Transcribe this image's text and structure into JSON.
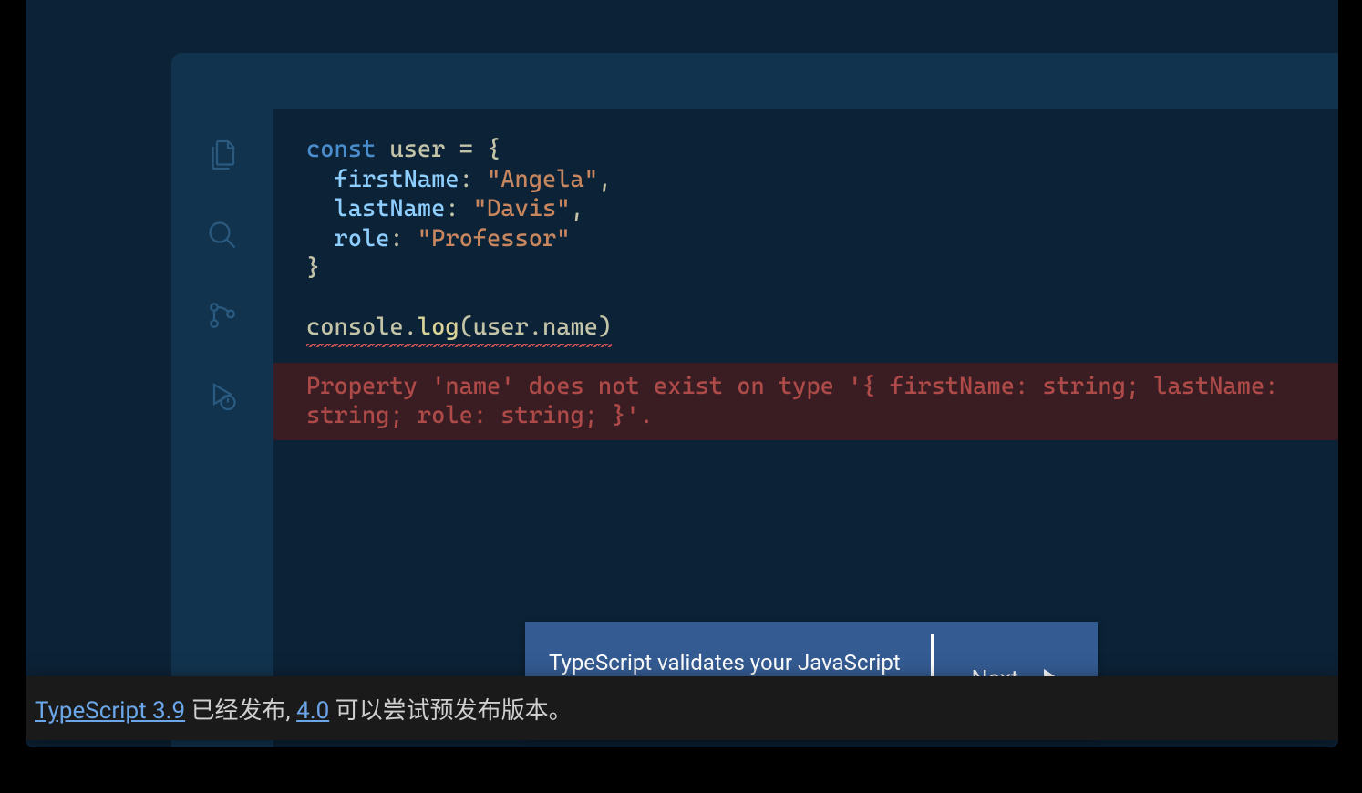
{
  "code": {
    "line1_kw": "const",
    "line1_ident": " user ",
    "line1_eq": "= {",
    "line2_prop": "firstName",
    "line2_colon": ": ",
    "line2_val": "\"Angela\"",
    "line2_comma": ",",
    "line3_prop": "lastName",
    "line3_colon": ": ",
    "line3_val": "\"Davis\"",
    "line3_comma": ",",
    "line4_prop": "role",
    "line4_colon": ": ",
    "line4_val": "\"Professor\"",
    "line5_close": "}",
    "line7_obj": "console",
    "line7_dot": ".",
    "line7_method": "log",
    "line7_open": "(",
    "line7_arg1": "user",
    "line7_dot2": ".",
    "line7_arg2": "name",
    "line7_close": ")"
  },
  "error": {
    "message": "Property 'name' does not exist on type '{ firstName: string; lastName: string; role: string; }'."
  },
  "explain": {
    "text": "TypeScript validates your JavaScript ahead of time",
    "next": "Next"
  },
  "bottom": {
    "link1": "TypeScript 3.9",
    "text1": " 已经发布, ",
    "link2": "4.0",
    "text2": " 可以尝试预发布版本。"
  }
}
